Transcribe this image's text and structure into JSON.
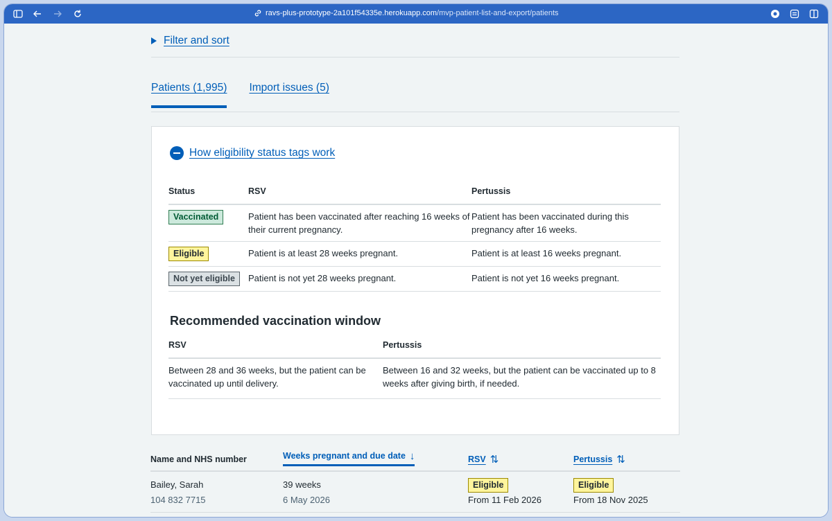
{
  "browser": {
    "url_domain": "ravs-plus-prototype-2a101f54335e.herokuapp.com",
    "url_path": "/mvp-patient-list-and-export/patients",
    "icons": [
      "sidebar-icon",
      "back-arrow-icon",
      "forward-arrow-icon",
      "reload-icon",
      "link-icon",
      "extension-icon",
      "reader-icon",
      "split-view-icon"
    ]
  },
  "filter": {
    "label": "Filter and sort"
  },
  "tabs": [
    {
      "label": "Patients (1,995)",
      "active": true
    },
    {
      "label": "Import issues (5)",
      "active": false
    }
  ],
  "eligibility": {
    "toggle_label": "How eligibility status tags work",
    "headers": {
      "status": "Status",
      "rsv": "RSV",
      "pertussis": "Pertussis"
    },
    "rows": [
      {
        "tag": "Vaccinated",
        "tag_color": "#cce9dc",
        "rsv": "Patient has been vaccinated after reaching 16 weeks of their current pregnancy.",
        "pertussis": "Patient has been vaccinated during this pregnancy after 16 weeks."
      },
      {
        "tag": "Eligible",
        "tag_color": "#fff59d",
        "rsv": "Patient is at least 28 weeks pregnant.",
        "pertussis": "Patient is at least 16 weeks pregnant."
      },
      {
        "tag": "Not yet eligible",
        "tag_color": "#dbe1e4",
        "rsv": "Patient is not yet 28 weeks pregnant.",
        "pertussis": "Patient is not yet 16 weeks pregnant."
      }
    ]
  },
  "window": {
    "heading": "Recommended vaccination window",
    "headers": {
      "rsv": "RSV",
      "pertussis": "Pertussis"
    },
    "rsv": "Between 28 and 36 weeks, but the patient can be vaccinated up until delivery.",
    "pertussis": "Between 16 and 32 weeks, but the patient can be vaccinated up to 8 weeks after giving birth, if needed."
  },
  "patients": {
    "headers": {
      "name": "Name and NHS number",
      "weeks": "Weeks pregnant and due date",
      "rsv": "RSV",
      "pertussis": "Pertussis"
    },
    "rows": [
      {
        "name": "Bailey, Sarah",
        "nhs": "104 832 7715",
        "weeks": "39 weeks",
        "due": "6 May 2026",
        "rsv_tag": "Eligible",
        "rsv_from": "From 11 Feb 2026",
        "pertussis_tag": "Eligible",
        "pertussis_from": "From 18 Nov 2025"
      }
    ]
  }
}
